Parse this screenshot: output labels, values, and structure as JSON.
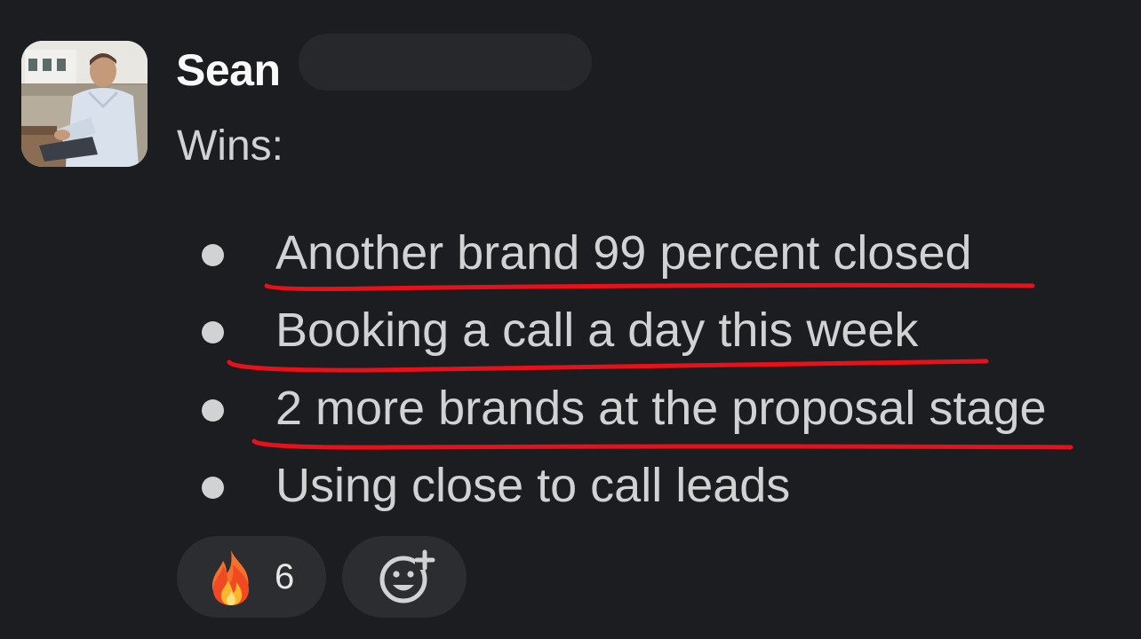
{
  "message": {
    "sender": "Sean",
    "intro": "Wins:",
    "bullets": [
      "Another brand 99 percent closed",
      "Booking a call a day this week",
      "2 more brands at the proposal stage",
      "Using close to call leads"
    ],
    "underlined_bullet_indices": [
      0,
      1,
      2
    ],
    "annotation_color": "#e8111a"
  },
  "reactions": [
    {
      "emoji": "fire-icon",
      "count": "6"
    }
  ],
  "add_reaction_icon": "add-emoji-icon"
}
